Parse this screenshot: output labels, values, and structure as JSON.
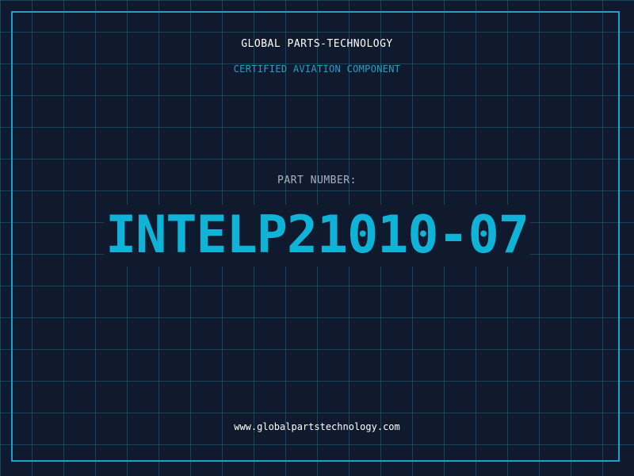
{
  "company": {
    "name": "GLOBAL PARTS-TECHNOLOGY",
    "tagline": "CERTIFIED AVIATION COMPONENT"
  },
  "part": {
    "label": "PART NUMBER:",
    "number": "INTELP21010-07"
  },
  "footer": {
    "website": "www.globalpartstechnology.com"
  },
  "colors": {
    "background": "#101a2e",
    "grid": "#16697d",
    "accent": "#1aa3c9",
    "part_number": "#0fb3d8",
    "label": "#a4b3c7",
    "text": "#ffffff"
  }
}
